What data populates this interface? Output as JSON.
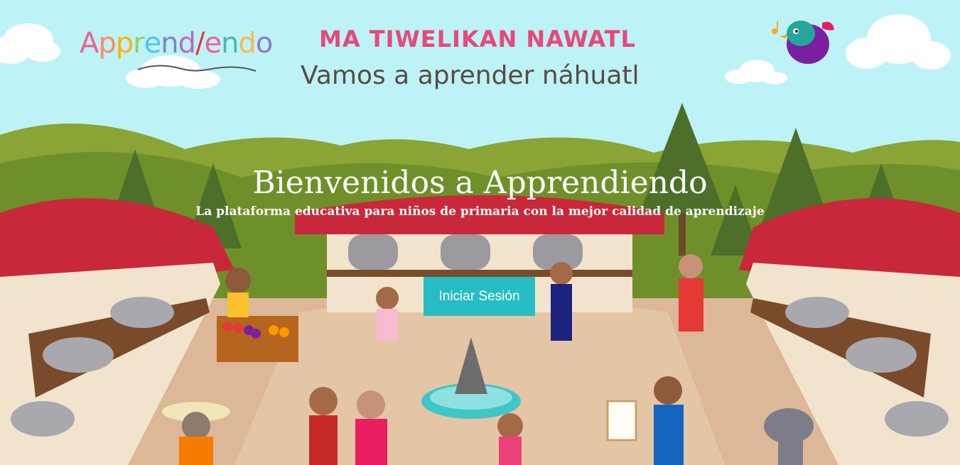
{
  "brand": {
    "name_letters": [
      "A",
      "p",
      "p",
      "r",
      "e",
      "n",
      "d",
      "/",
      "e",
      "n",
      "d",
      "o"
    ],
    "name_colors": [
      "#f06292",
      "#ff8a65",
      "#ffb300",
      "#9ccc65",
      "#4fc3f7",
      "#7986cb",
      "#ba68c8",
      "#e53935",
      "#f06292",
      "#4db6ac",
      "#ffb74d",
      "#9575cd"
    ]
  },
  "header": {
    "title_nawatl": "MA TIWELIKAN NAWATL",
    "title_es": "Vamos a aprender náhuatl"
  },
  "hero": {
    "title": "Bienvenidos a Apprendiendo",
    "subtitle": "La plataforma educativa para niños de primaria con la mejor calidad de aprendizaje"
  },
  "actions": {
    "login_label": "Iniciar Sesión"
  },
  "colors": {
    "sky": "#bdf3f7",
    "accent": "#26bdc5",
    "title_pink": "#e8497a",
    "roof_red": "#c8283a",
    "ground": "#dcb898"
  },
  "icons": {
    "bird": "bird-mascot-icon",
    "music": "music-note-icon"
  }
}
